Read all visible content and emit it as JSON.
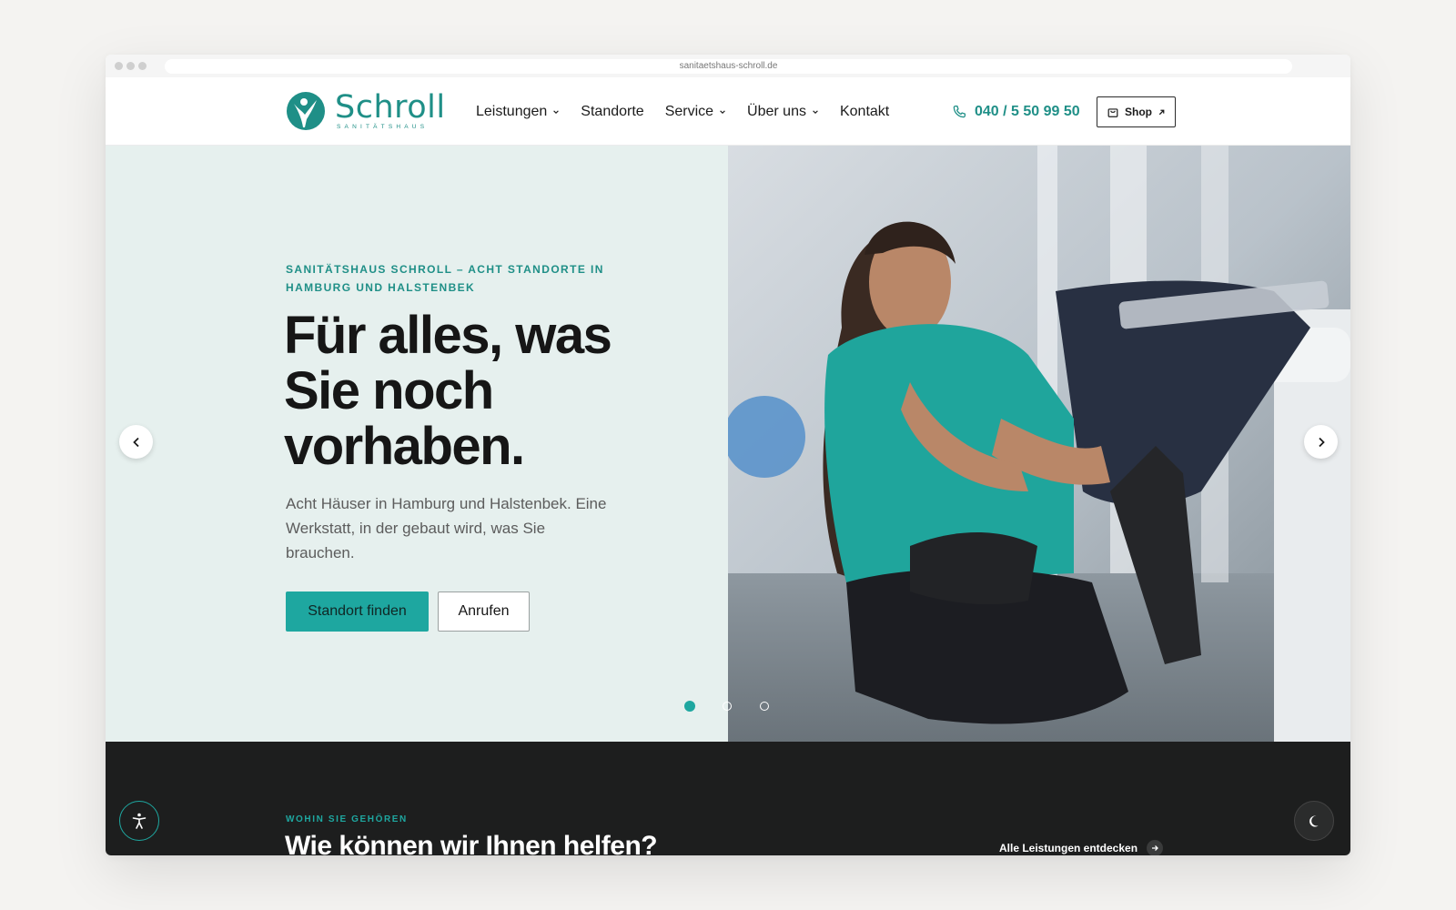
{
  "browser": {
    "url": "sanitaetshaus-schroll.de"
  },
  "header": {
    "logo_name": "Schroll",
    "logo_sub": "SANITÄTSHAUS",
    "nav": [
      {
        "label": "Leistungen",
        "has_dropdown": true
      },
      {
        "label": "Standorte",
        "has_dropdown": false
      },
      {
        "label": "Service",
        "has_dropdown": true
      },
      {
        "label": "Über uns",
        "has_dropdown": true
      },
      {
        "label": "Kontakt",
        "has_dropdown": false
      }
    ],
    "phone": "040 / 5 50 99 50",
    "shop_label": "Shop"
  },
  "hero": {
    "eyebrow": "SANITÄTSHAUS SCHROLL – ACHT STANDORTE IN HAMBURG UND HALSTENBEK",
    "headline": "Für alles, was Sie noch vorhaben.",
    "lede": "Acht Häuser in Hamburg und Halstenbek. Eine Werkstatt, in der gebaut wird, was Sie brauchen.",
    "primary_cta": "Standort finden",
    "secondary_cta": "Anrufen",
    "slides": 3,
    "active_slide": 1
  },
  "section": {
    "eyebrow": "WOHIN SIE GEHÖREN",
    "title": "Wie können wir Ihnen helfen?",
    "link": "Alle Leistungen entdecken"
  },
  "colors": {
    "brand": "#1f8f87",
    "accent": "#1ea7a0",
    "hero_bg": "#e6f0ee",
    "dark_bg": "#1d1e1e"
  }
}
